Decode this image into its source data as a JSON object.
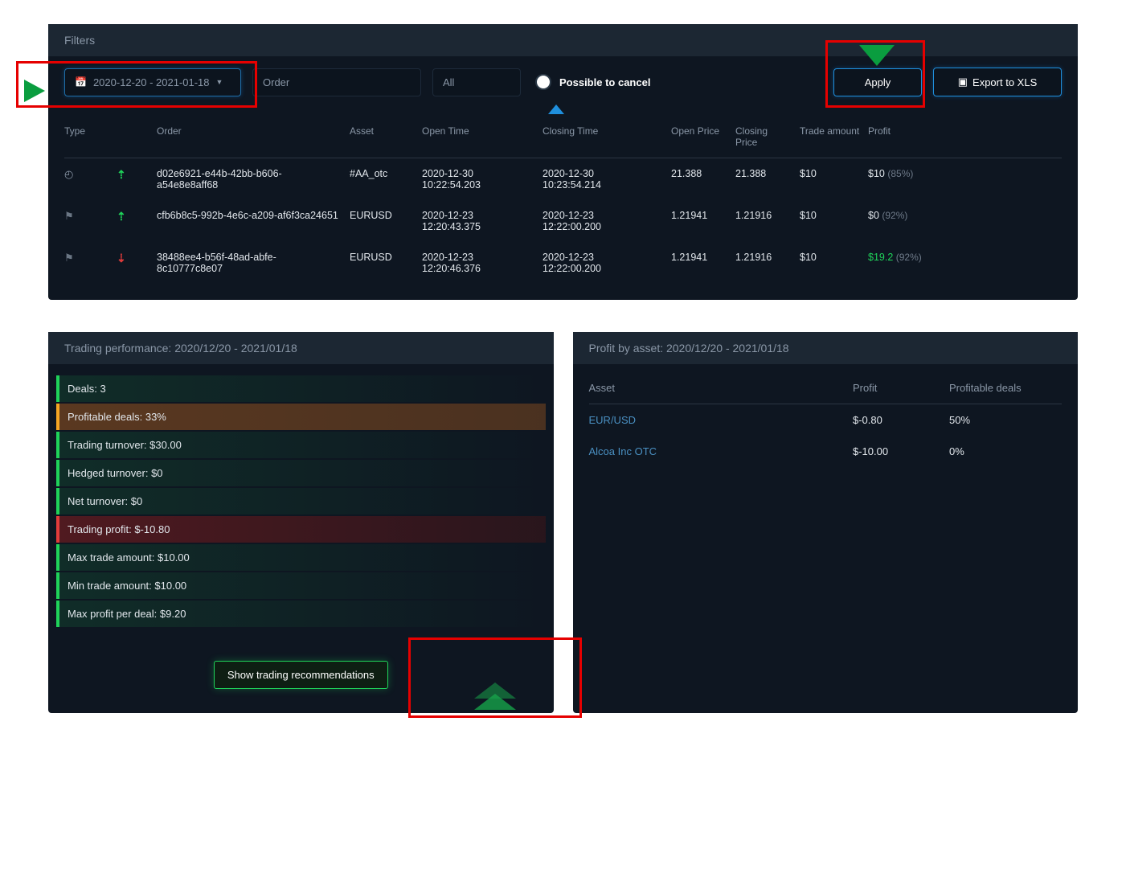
{
  "filters": {
    "title": "Filters",
    "date_range": "2020-12-20 - 2021-01-18",
    "order_placeholder": "Order",
    "all_placeholder": "All",
    "possible_to_cancel": "Possible to cancel",
    "apply": "Apply",
    "export": "Export to XLS"
  },
  "table": {
    "headers": {
      "type": "Type",
      "order": "Order",
      "asset": "Asset",
      "open_time": "Open Time",
      "closing_time": "Closing Time",
      "open_price": "Open Price",
      "closing_price": "Closing Price",
      "trade_amount": "Trade amount",
      "profit": "Profit"
    },
    "rows": [
      {
        "type_icon": "clock",
        "dir": "up",
        "order": "d02e6921-e44b-42bb-b606-a54e8e8aff68",
        "asset": "#AA_otc",
        "open_time": "2020-12-30 10:22:54.203",
        "closing_time": "2020-12-30 10:23:54.214",
        "open_price": "21.388",
        "closing_price": "21.388",
        "trade_amount": "$10",
        "profit": "$10",
        "profit_pct": "(85%)",
        "profit_class": ""
      },
      {
        "type_icon": "flag",
        "dir": "up",
        "order": "cfb6b8c5-992b-4e6c-a209-af6f3ca24651",
        "asset": "EURUSD",
        "open_time": "2020-12-23 12:20:43.375",
        "closing_time": "2020-12-23 12:22:00.200",
        "open_price": "1.21941",
        "closing_price": "1.21916",
        "trade_amount": "$10",
        "profit": "$0",
        "profit_pct": "(92%)",
        "profit_class": ""
      },
      {
        "type_icon": "flag",
        "dir": "down",
        "order": "38488ee4-b56f-48ad-abfe-8c10777c8e07",
        "asset": "EURUSD",
        "open_time": "2020-12-23 12:20:46.376",
        "closing_time": "2020-12-23 12:22:00.200",
        "open_price": "1.21941",
        "closing_price": "1.21916",
        "trade_amount": "$10",
        "profit": "$19.2",
        "profit_pct": "(92%)",
        "profit_class": "profit-green"
      }
    ]
  },
  "perf": {
    "title": "Trading performance: 2020/12/20 - 2021/01/18",
    "rows": [
      {
        "label": "Deals: 3",
        "class": "bl-green"
      },
      {
        "label": "Profitable deals: 33%",
        "class": "bl-orange"
      },
      {
        "label": "Trading turnover: $30.00",
        "class": "bl-green"
      },
      {
        "label": "Hedged turnover: $0",
        "class": "bl-green"
      },
      {
        "label": "Net turnover: $0",
        "class": "bl-green"
      },
      {
        "label": "Trading profit: $-10.80",
        "class": "bl-red"
      },
      {
        "label": "Max trade amount: $10.00",
        "class": "bl-green"
      },
      {
        "label": "Min trade amount: $10.00",
        "class": "bl-green"
      },
      {
        "label": "Max profit per deal: $9.20",
        "class": "bl-green"
      }
    ]
  },
  "by_asset": {
    "title": "Profit by asset: 2020/12/20 - 2021/01/18",
    "headers": {
      "asset": "Asset",
      "profit": "Profit",
      "profitable": "Profitable deals"
    },
    "rows": [
      {
        "asset": "EUR/USD",
        "profit": "$-0.80",
        "profitable": "50%"
      },
      {
        "asset": "Alcoa Inc OTC",
        "profit": "$-10.00",
        "profitable": "0%"
      }
    ]
  },
  "recommend_btn": "Show trading recommendations"
}
